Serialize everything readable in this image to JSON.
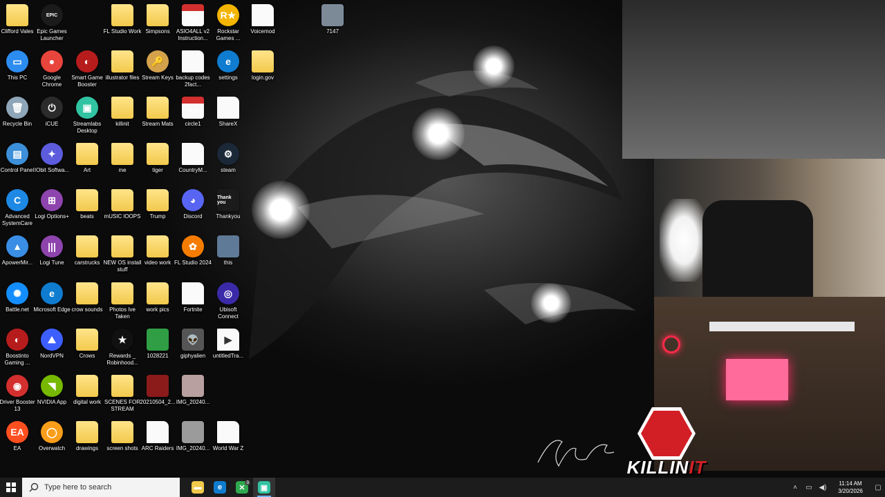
{
  "desktop_icons": [
    {
      "label": "Clifford Vales",
      "kind": "folder",
      "glyph": ""
    },
    {
      "label": "Epic Games Launcher",
      "kind": "app",
      "glyph": "EPIC",
      "color": "#1b1b1b"
    },
    {
      "label": "FL Studio Work",
      "kind": "folder",
      "glyph": ""
    },
    {
      "label": "Simpsons",
      "kind": "folder",
      "glyph": ""
    },
    {
      "label": "ASIO4ALL v2 Instruction...",
      "kind": "pdf",
      "glyph": "PDF"
    },
    {
      "label": "Rockstar Games ...",
      "kind": "app",
      "glyph": "R★",
      "color": "#f4b400"
    },
    {
      "label": "Voicemod",
      "kind": "doc",
      "glyph": ""
    },
    {
      "label": "7147",
      "kind": "image",
      "glyph": "",
      "color": "#7c8a98"
    },
    {
      "label": "This PC",
      "kind": "app",
      "glyph": "▭",
      "color": "#2d8cf0"
    },
    {
      "label": "Google Chrome",
      "kind": "app",
      "glyph": "●",
      "color": "#e8453c"
    },
    {
      "label": "Smart Game Booster",
      "kind": "app",
      "glyph": "◐",
      "color": "#b71c1c"
    },
    {
      "label": "illustrator files",
      "kind": "folder",
      "glyph": ""
    },
    {
      "label": "Stream Keys",
      "kind": "app",
      "glyph": "🔑",
      "color": "#d4a24c"
    },
    {
      "label": "backup codes 2fact...",
      "kind": "doc",
      "glyph": ""
    },
    {
      "label": "settings",
      "kind": "app",
      "glyph": "e",
      "color": "#0f7ccf"
    },
    {
      "label": "login.gov",
      "kind": "folder",
      "glyph": ""
    },
    {
      "label": "Recycle Bin",
      "kind": "app",
      "glyph": "🗑",
      "color": "#8fa6b8"
    },
    {
      "label": "iCUE",
      "kind": "app",
      "glyph": "⏻",
      "color": "#2b2b2b"
    },
    {
      "label": "killinit",
      "kind": "folder",
      "glyph": ""
    },
    {
      "label": "Stream Mats",
      "kind": "folder",
      "glyph": ""
    },
    {
      "label": "circle1",
      "kind": "pdf",
      "glyph": "PDF"
    },
    {
      "label": "ShareX",
      "kind": "doc",
      "glyph": ""
    },
    {
      "label": "Streamlabs Desktop",
      "kind": "app",
      "glyph": "▣",
      "color": "#31c3a2"
    },
    {
      "label": "Control Panel",
      "kind": "app",
      "glyph": "▤",
      "color": "#3c8fd8"
    },
    {
      "label": "IObit Softwa...",
      "kind": "app",
      "glyph": "✦",
      "color": "#5c5cdc"
    },
    {
      "label": "Art",
      "kind": "folder",
      "glyph": ""
    },
    {
      "label": "me",
      "kind": "folder",
      "glyph": ""
    },
    {
      "label": "tiger",
      "kind": "folder",
      "glyph": ""
    },
    {
      "label": "CountryM...",
      "kind": "doc",
      "glyph": ""
    },
    {
      "label": "steam",
      "kind": "app",
      "glyph": "⚙",
      "color": "#1b2838"
    },
    {
      "label": "Advanced SystemCare",
      "kind": "app",
      "glyph": "C",
      "color": "#1e88e5"
    },
    {
      "label": "Logi Options+",
      "kind": "app",
      "glyph": "⊞",
      "color": "#8e44ad"
    },
    {
      "label": "beats",
      "kind": "folder",
      "glyph": ""
    },
    {
      "label": "mUSIC lOOPS",
      "kind": "folder",
      "glyph": ""
    },
    {
      "label": "Trump",
      "kind": "folder",
      "glyph": ""
    },
    {
      "label": "Discord",
      "kind": "app",
      "glyph": "◕",
      "color": "#5865f2"
    },
    {
      "label": "Thankyou",
      "kind": "image",
      "glyph": "Thank you",
      "color": "#1b1b1b"
    },
    {
      "label": "ApowerMir...",
      "kind": "app",
      "glyph": "▲",
      "color": "#3a8ee6"
    },
    {
      "label": "Logi Tune",
      "kind": "app",
      "glyph": "|||",
      "color": "#8e44ad"
    },
    {
      "label": "carstrucks",
      "kind": "folder",
      "glyph": ""
    },
    {
      "label": "NEW OS install stuff",
      "kind": "folder",
      "glyph": ""
    },
    {
      "label": "video work",
      "kind": "folder",
      "glyph": ""
    },
    {
      "label": "FL Studio 2024",
      "kind": "app",
      "glyph": "✿",
      "color": "#f57c00"
    },
    {
      "label": "this",
      "kind": "image",
      "glyph": "",
      "color": "#5f7a96"
    },
    {
      "label": "Battle.net",
      "kind": "app",
      "glyph": "✺",
      "color": "#148eff"
    },
    {
      "label": "Microsoft Edge",
      "kind": "app",
      "glyph": "e",
      "color": "#0f7ccf"
    },
    {
      "label": "crow sounds",
      "kind": "folder",
      "glyph": ""
    },
    {
      "label": "Photos Ive Taken",
      "kind": "folder",
      "glyph": ""
    },
    {
      "label": "work pics",
      "kind": "folder",
      "glyph": ""
    },
    {
      "label": "Fortnite",
      "kind": "doc",
      "glyph": ""
    },
    {
      "label": "Ubisoft Connect",
      "kind": "app",
      "glyph": "◎",
      "color": "#3b2aa8"
    },
    {
      "label": "Boostinto Gaming ...",
      "kind": "app",
      "glyph": "◐",
      "color": "#b71c1c"
    },
    {
      "label": "NordVPN",
      "kind": "app",
      "glyph": "⛰",
      "color": "#3e5fff"
    },
    {
      "label": "Crows",
      "kind": "folder",
      "glyph": ""
    },
    {
      "label": "Rewards _ Robinhood...",
      "kind": "app",
      "glyph": "★",
      "color": "#111"
    },
    {
      "label": "1028221",
      "kind": "image",
      "glyph": "",
      "color": "#2f9e44"
    },
    {
      "label": "giphyalien",
      "kind": "image",
      "glyph": "👽",
      "color": "#555"
    },
    {
      "label": "untitledTra...",
      "kind": "doc",
      "glyph": "▶"
    },
    {
      "label": "Driver Booster 13",
      "kind": "app",
      "glyph": "◉",
      "color": "#d32f2f"
    },
    {
      "label": "NVIDIA App",
      "kind": "app",
      "glyph": "◥",
      "color": "#76b900"
    },
    {
      "label": "digital work",
      "kind": "folder",
      "glyph": ""
    },
    {
      "label": "SCENES FOR STREAM",
      "kind": "folder",
      "glyph": ""
    },
    {
      "label": "20210504_2...",
      "kind": "image",
      "glyph": "",
      "color": "#8b1a1a"
    },
    {
      "label": "IMG_20240...",
      "kind": "image",
      "glyph": "",
      "color": "#b8a0a0"
    },
    {
      "label": "EA",
      "kind": "app",
      "glyph": "EA",
      "color": "#ff4f1f"
    },
    {
      "label": "Overwatch",
      "kind": "app",
      "glyph": "◯",
      "color": "#f99e1a"
    },
    {
      "label": "drawings",
      "kind": "folder",
      "glyph": ""
    },
    {
      "label": "screen shots",
      "kind": "folder",
      "glyph": ""
    },
    {
      "label": "ARC Raiders",
      "kind": "doc",
      "glyph": ""
    },
    {
      "label": "IMG_20240...",
      "kind": "image",
      "glyph": "",
      "color": "#9b9b9b"
    },
    {
      "label": "World War Z",
      "kind": "doc",
      "glyph": ""
    }
  ],
  "overlay": {
    "brand_prefix": "KILLIN",
    "brand_suffix": "IT"
  },
  "taskbar": {
    "search_placeholder": "Type here to search",
    "apps": [
      {
        "name": "file-explorer",
        "glyph": "▬",
        "color": "#f2c94c"
      },
      {
        "name": "edge",
        "glyph": "e",
        "color": "#0f7ccf"
      },
      {
        "name": "xbox",
        "glyph": "✕",
        "color": "#2fa84f",
        "badge": "3"
      },
      {
        "name": "streamlabs",
        "glyph": "▣",
        "color": "#31c3a2",
        "active": true
      }
    ],
    "time": "11:14 AM",
    "date": "3/20/2026"
  }
}
